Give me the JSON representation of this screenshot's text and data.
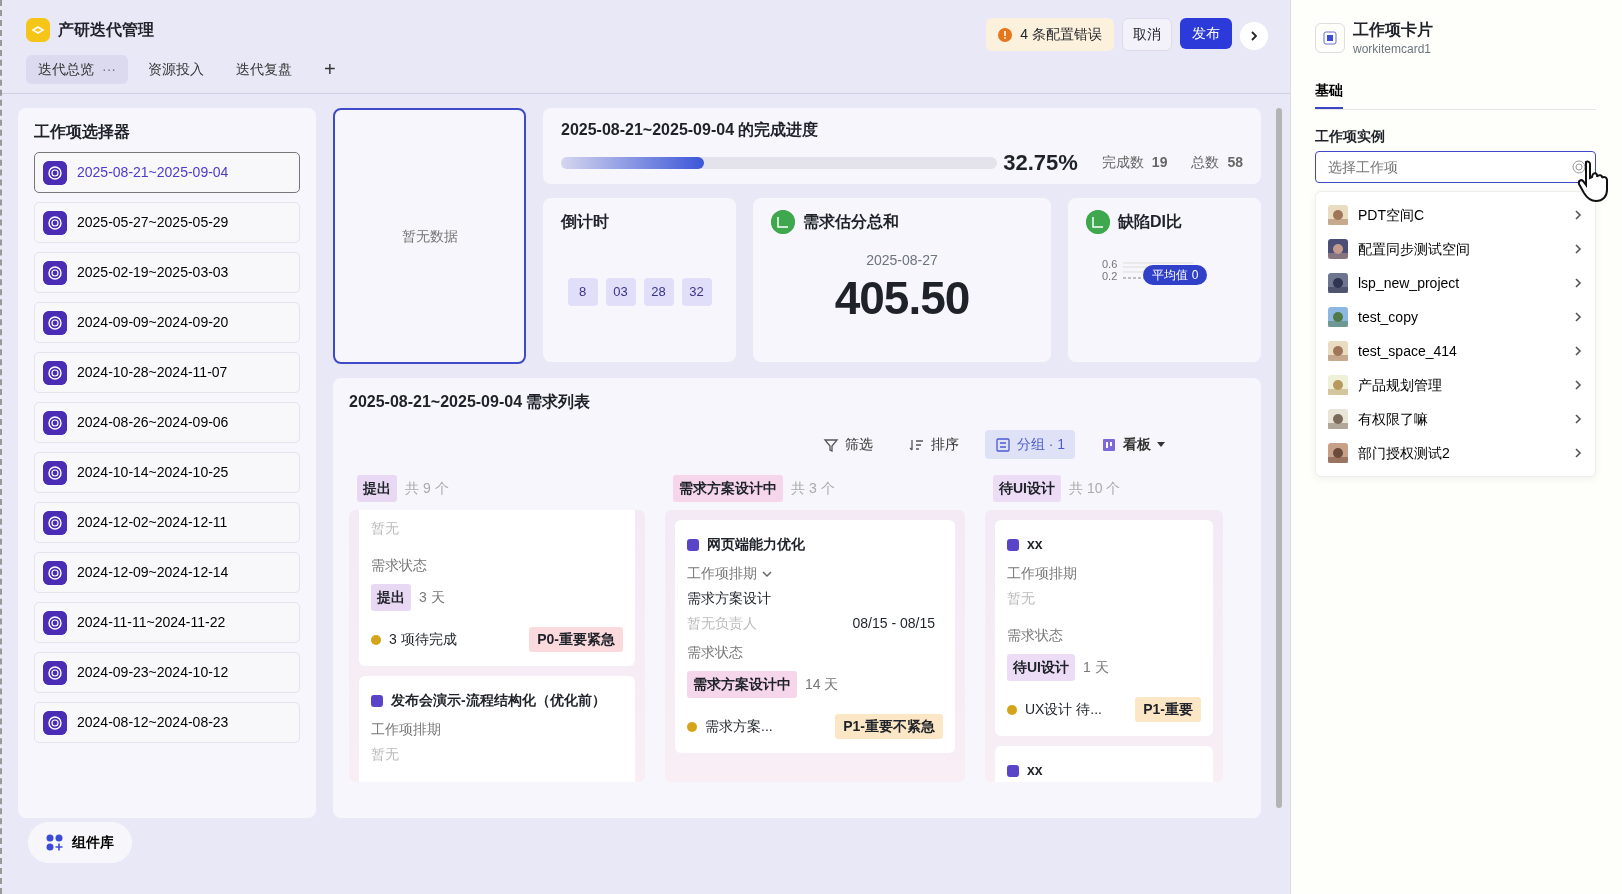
{
  "app": {
    "title": "产研迭代管理"
  },
  "page_tabs": [
    {
      "label": "迭代总览",
      "selected": true,
      "more": "···"
    },
    {
      "label": "资源投入",
      "selected": false
    },
    {
      "label": "迭代复盘",
      "selected": false
    }
  ],
  "add_tab": "+",
  "header_actions": {
    "errors": "4 条配置错误",
    "cancel": "取消",
    "publish": "发布"
  },
  "selector": {
    "title": "工作项选择器",
    "items": [
      {
        "label": "2025-08-21~2025-09-04",
        "selected": true
      },
      {
        "label": "2025-05-27~2025-05-29",
        "selected": false
      },
      {
        "label": "2025-02-19~2025-03-03",
        "selected": false
      },
      {
        "label": "2024-09-09~2024-09-20",
        "selected": false
      },
      {
        "label": "2024-10-28~2024-11-07",
        "selected": false
      },
      {
        "label": "2024-08-26~2024-09-06",
        "selected": false
      },
      {
        "label": "2024-10-14~2024-10-25",
        "selected": false
      },
      {
        "label": "2024-12-02~2024-12-11",
        "selected": false
      },
      {
        "label": "2024-12-09~2024-12-14",
        "selected": false
      },
      {
        "label": "2024-11-11~2024-11-22",
        "selected": false
      },
      {
        "label": "2024-09-23~2024-10-12",
        "selected": false
      },
      {
        "label": "2024-08-12~2024-08-23",
        "selected": false
      }
    ]
  },
  "empty_card": {
    "text": "暂无数据",
    "selected": true
  },
  "progress": {
    "title": "2025-08-21~2025-09-04 的完成进度",
    "level": 0.3275,
    "percent": "32.75%",
    "done_label": "完成数",
    "done": "19",
    "total_label": "总数",
    "total": "58"
  },
  "countdown": {
    "title": "倒计时",
    "units": [
      "8",
      "03",
      "28",
      "32"
    ]
  },
  "estimate": {
    "title": "需求估分总和",
    "date": "2025-08-27",
    "value": "405.50"
  },
  "defect": {
    "title": "缺陷DI比",
    "ticks": [
      "0.6",
      "0.2"
    ],
    "tooltip": "平均值 0"
  },
  "requirements": {
    "title": "2025-08-21~2025-09-04 需求列表",
    "toolbar": [
      {
        "label": "筛选",
        "kind": "filter",
        "selected": false
      },
      {
        "label": "排序",
        "kind": "sort",
        "selected": false
      },
      {
        "label": "分组 · 1",
        "kind": "group",
        "selected": true
      },
      {
        "label": "看板",
        "kind": "view",
        "selected": false
      }
    ],
    "columns": [
      {
        "status": "提出",
        "count": "共 9 个",
        "color": "#e8d8f3",
        "scrolled": true,
        "cards": [
          {
            "schedule_value": "暂无",
            "status_label": "需求状态",
            "status": "提出",
            "days": "3 天",
            "todo": "3 项待完成",
            "priority": "P0-重要紧急",
            "color": "#fbdadd"
          },
          {
            "title": "发布会演示-流程结构化（优化前）",
            "schedule_label": "工作项排期",
            "schedule_value": "暂无"
          }
        ]
      },
      {
        "status": "需求方案设计中",
        "count": "共 3 个",
        "color": "#f6d6ea",
        "scrolled": false,
        "cards": [
          {
            "title": "网页端能力优化",
            "schedule_label": "工作项排期",
            "expandable": true,
            "stage": "需求方案设计",
            "owner": "暂无负责人",
            "dates": "08/15 - 08/15",
            "status_label": "需求状态",
            "status": "需求方案设计中",
            "days": "14 天",
            "todo": "需求方案...",
            "priority": "P1-重要不紧急",
            "color": "#fbe6c6"
          }
        ]
      },
      {
        "status": "待UI设计",
        "count": "共 10 个",
        "color": "#ecdcf6",
        "scrolled": false,
        "cards": [
          {
            "title": "xx",
            "schedule_label": "工作项排期",
            "schedule_value": "暂无",
            "status_label": "需求状态",
            "status": "待UI设计",
            "days": "1 天",
            "todo": "UX设计 待...",
            "priority": "P1-重要",
            "color": "#fbe6c6"
          },
          {
            "title": "xx"
          }
        ]
      }
    ]
  },
  "component_library": "组件库",
  "inspector": {
    "title": "工作项卡片",
    "subtitle": "workitemcard1",
    "tabs": [
      {
        "label": "基础",
        "selected": true
      }
    ],
    "field_label": "工作项实例",
    "placeholder": "选择工作项",
    "options": [
      "PDT空间C",
      "配置同步测试空间",
      "lsp_new_project",
      "test_copy",
      "test_space_414",
      "产品规划管理",
      "有权限了嘛",
      "部门授权测试2"
    ]
  }
}
